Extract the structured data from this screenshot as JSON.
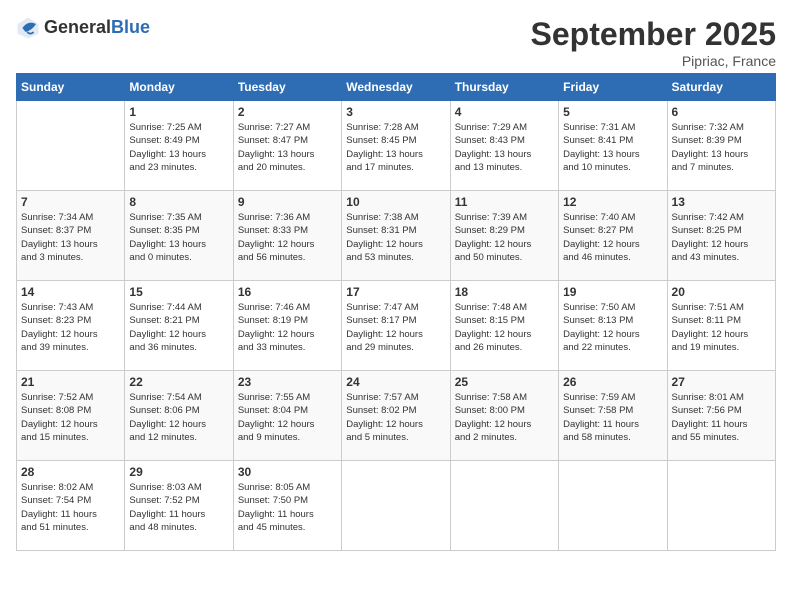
{
  "logo": {
    "text_general": "General",
    "text_blue": "Blue"
  },
  "title": "September 2025",
  "location": "Pipriac, France",
  "days_of_week": [
    "Sunday",
    "Monday",
    "Tuesday",
    "Wednesday",
    "Thursday",
    "Friday",
    "Saturday"
  ],
  "weeks": [
    [
      {
        "day": "",
        "info": ""
      },
      {
        "day": "1",
        "info": "Sunrise: 7:25 AM\nSunset: 8:49 PM\nDaylight: 13 hours\nand 23 minutes."
      },
      {
        "day": "2",
        "info": "Sunrise: 7:27 AM\nSunset: 8:47 PM\nDaylight: 13 hours\nand 20 minutes."
      },
      {
        "day": "3",
        "info": "Sunrise: 7:28 AM\nSunset: 8:45 PM\nDaylight: 13 hours\nand 17 minutes."
      },
      {
        "day": "4",
        "info": "Sunrise: 7:29 AM\nSunset: 8:43 PM\nDaylight: 13 hours\nand 13 minutes."
      },
      {
        "day": "5",
        "info": "Sunrise: 7:31 AM\nSunset: 8:41 PM\nDaylight: 13 hours\nand 10 minutes."
      },
      {
        "day": "6",
        "info": "Sunrise: 7:32 AM\nSunset: 8:39 PM\nDaylight: 13 hours\nand 7 minutes."
      }
    ],
    [
      {
        "day": "7",
        "info": "Sunrise: 7:34 AM\nSunset: 8:37 PM\nDaylight: 13 hours\nand 3 minutes."
      },
      {
        "day": "8",
        "info": "Sunrise: 7:35 AM\nSunset: 8:35 PM\nDaylight: 13 hours\nand 0 minutes."
      },
      {
        "day": "9",
        "info": "Sunrise: 7:36 AM\nSunset: 8:33 PM\nDaylight: 12 hours\nand 56 minutes."
      },
      {
        "day": "10",
        "info": "Sunrise: 7:38 AM\nSunset: 8:31 PM\nDaylight: 12 hours\nand 53 minutes."
      },
      {
        "day": "11",
        "info": "Sunrise: 7:39 AM\nSunset: 8:29 PM\nDaylight: 12 hours\nand 50 minutes."
      },
      {
        "day": "12",
        "info": "Sunrise: 7:40 AM\nSunset: 8:27 PM\nDaylight: 12 hours\nand 46 minutes."
      },
      {
        "day": "13",
        "info": "Sunrise: 7:42 AM\nSunset: 8:25 PM\nDaylight: 12 hours\nand 43 minutes."
      }
    ],
    [
      {
        "day": "14",
        "info": "Sunrise: 7:43 AM\nSunset: 8:23 PM\nDaylight: 12 hours\nand 39 minutes."
      },
      {
        "day": "15",
        "info": "Sunrise: 7:44 AM\nSunset: 8:21 PM\nDaylight: 12 hours\nand 36 minutes."
      },
      {
        "day": "16",
        "info": "Sunrise: 7:46 AM\nSunset: 8:19 PM\nDaylight: 12 hours\nand 33 minutes."
      },
      {
        "day": "17",
        "info": "Sunrise: 7:47 AM\nSunset: 8:17 PM\nDaylight: 12 hours\nand 29 minutes."
      },
      {
        "day": "18",
        "info": "Sunrise: 7:48 AM\nSunset: 8:15 PM\nDaylight: 12 hours\nand 26 minutes."
      },
      {
        "day": "19",
        "info": "Sunrise: 7:50 AM\nSunset: 8:13 PM\nDaylight: 12 hours\nand 22 minutes."
      },
      {
        "day": "20",
        "info": "Sunrise: 7:51 AM\nSunset: 8:11 PM\nDaylight: 12 hours\nand 19 minutes."
      }
    ],
    [
      {
        "day": "21",
        "info": "Sunrise: 7:52 AM\nSunset: 8:08 PM\nDaylight: 12 hours\nand 15 minutes."
      },
      {
        "day": "22",
        "info": "Sunrise: 7:54 AM\nSunset: 8:06 PM\nDaylight: 12 hours\nand 12 minutes."
      },
      {
        "day": "23",
        "info": "Sunrise: 7:55 AM\nSunset: 8:04 PM\nDaylight: 12 hours\nand 9 minutes."
      },
      {
        "day": "24",
        "info": "Sunrise: 7:57 AM\nSunset: 8:02 PM\nDaylight: 12 hours\nand 5 minutes."
      },
      {
        "day": "25",
        "info": "Sunrise: 7:58 AM\nSunset: 8:00 PM\nDaylight: 12 hours\nand 2 minutes."
      },
      {
        "day": "26",
        "info": "Sunrise: 7:59 AM\nSunset: 7:58 PM\nDaylight: 11 hours\nand 58 minutes."
      },
      {
        "day": "27",
        "info": "Sunrise: 8:01 AM\nSunset: 7:56 PM\nDaylight: 11 hours\nand 55 minutes."
      }
    ],
    [
      {
        "day": "28",
        "info": "Sunrise: 8:02 AM\nSunset: 7:54 PM\nDaylight: 11 hours\nand 51 minutes."
      },
      {
        "day": "29",
        "info": "Sunrise: 8:03 AM\nSunset: 7:52 PM\nDaylight: 11 hours\nand 48 minutes."
      },
      {
        "day": "30",
        "info": "Sunrise: 8:05 AM\nSunset: 7:50 PM\nDaylight: 11 hours\nand 45 minutes."
      },
      {
        "day": "",
        "info": ""
      },
      {
        "day": "",
        "info": ""
      },
      {
        "day": "",
        "info": ""
      },
      {
        "day": "",
        "info": ""
      }
    ]
  ]
}
